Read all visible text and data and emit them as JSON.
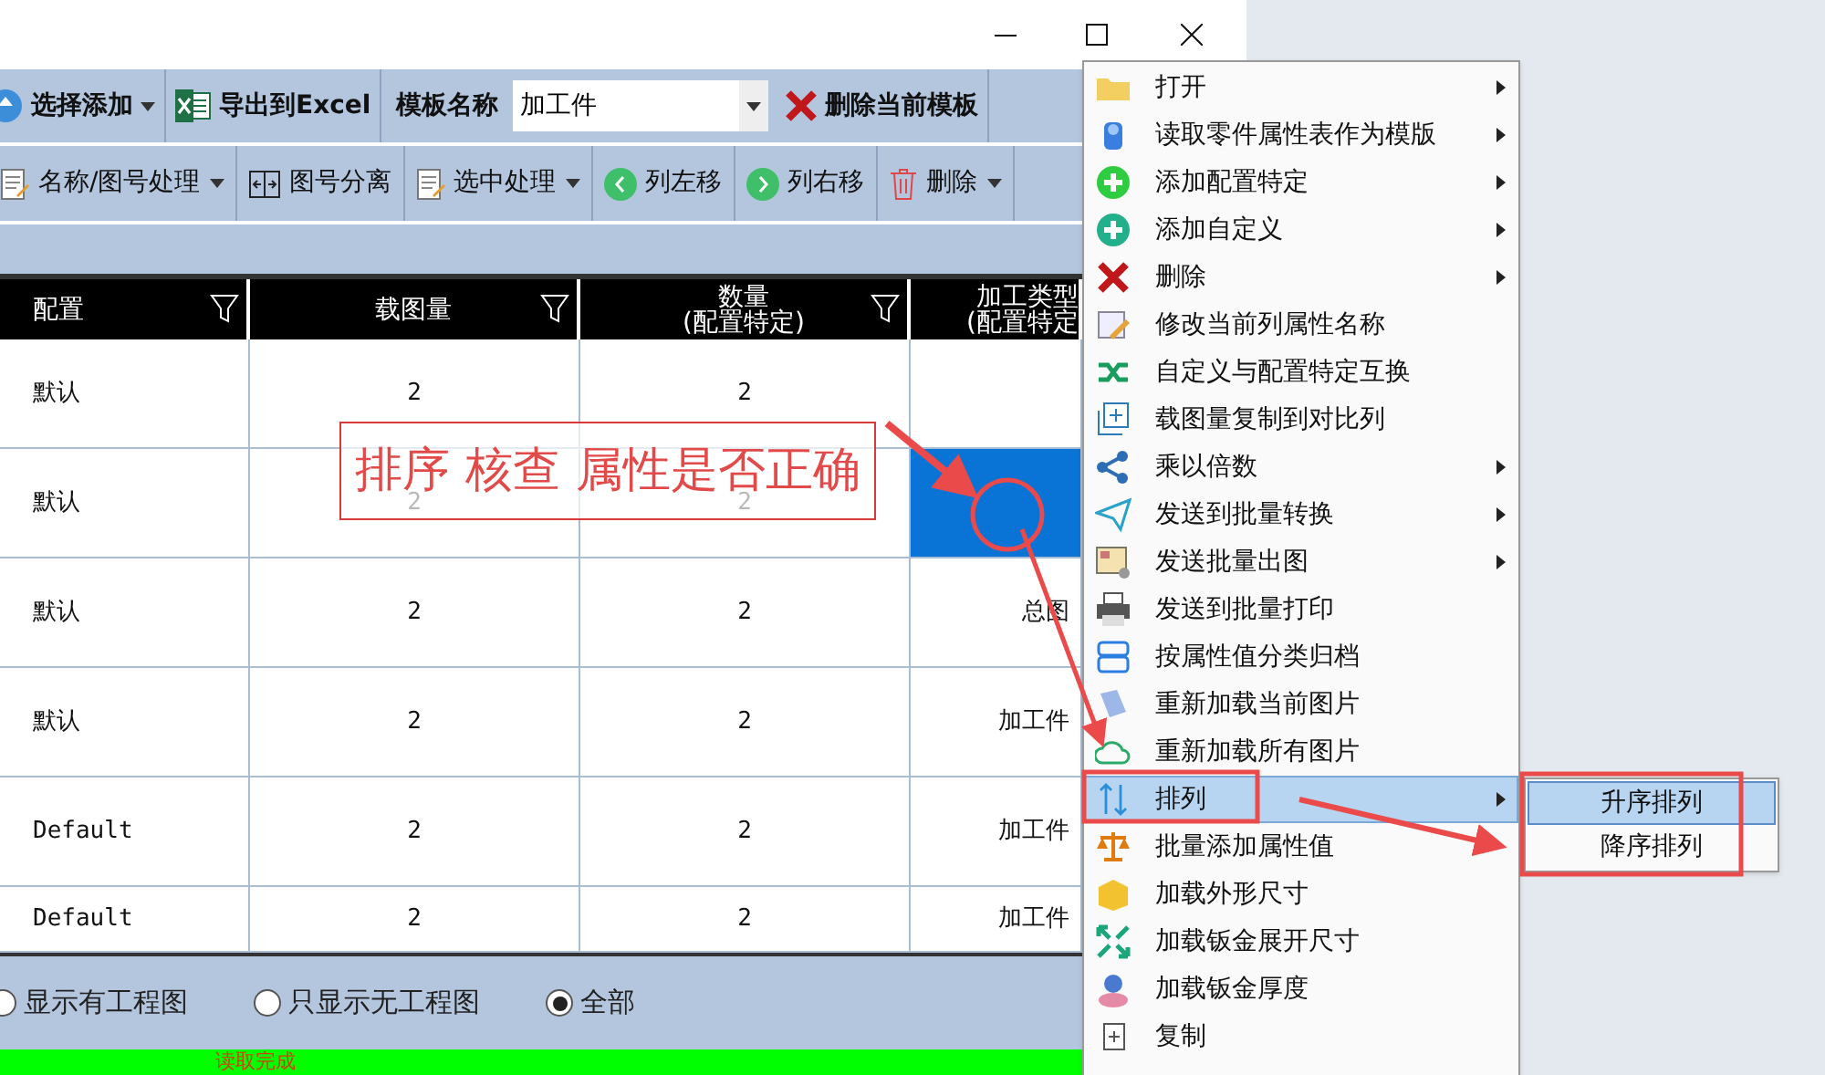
{
  "toolbar_1": [
    {
      "kind": "dropdown",
      "label": "选择添加"
    },
    {
      "kind": "excel",
      "label": "导出到Excel"
    },
    {
      "kind": "label",
      "label": "模板名称"
    },
    {
      "kind": "combo",
      "value": "加工件"
    },
    {
      "kind": "delete",
      "label": "删除当前模板"
    }
  ],
  "toolbar_2": [
    {
      "kind": "dropdown",
      "label": "名称/图号处理"
    },
    {
      "kind": "button",
      "label": "图号分离"
    },
    {
      "kind": "dropdown",
      "label": "选中处理"
    },
    {
      "kind": "left",
      "label": "列左移"
    },
    {
      "kind": "right",
      "label": "列右移"
    },
    {
      "kind": "trash",
      "label": "删除"
    }
  ],
  "table": {
    "columns": [
      {
        "title": "配置",
        "filter": true
      },
      {
        "title": "载图量",
        "filter": true
      },
      {
        "title": "数量",
        "subtitle": "(配置特定)",
        "filter": true
      },
      {
        "title": "加工类型",
        "subtitle": "(配置特定",
        "filter": false
      }
    ],
    "rows": [
      {
        "cells": [
          "默认",
          "2",
          "2"
        ],
        "selected": false
      },
      {
        "cells": [
          "默认",
          "2",
          "2"
        ],
        "selected": true
      },
      {
        "cells": [
          "默认",
          "2",
          "2",
          "总图"
        ],
        "selected": false
      },
      {
        "cells": [
          "默认",
          "2",
          "2",
          "加工件"
        ],
        "selected": false
      },
      {
        "cells": [
          "Default",
          "2",
          "2",
          "加工件"
        ],
        "selected": false
      },
      {
        "cells": [
          "Default",
          "2",
          "2",
          "加工件"
        ],
        "selected": false
      }
    ]
  },
  "filter_options": [
    {
      "label": "显示有工程图",
      "selected": false
    },
    {
      "label": "只显示无工程图",
      "selected": false
    },
    {
      "label": "全部",
      "selected": true
    }
  ],
  "status_bar": "读取完成",
  "annotation": "排序 核查 属性是否正确",
  "context_menu": [
    {
      "label": "打开",
      "submenu": true,
      "selected": false
    },
    {
      "label": "读取零件属性表作为模版",
      "submenu": true,
      "selected": false
    },
    {
      "label": "添加配置特定",
      "submenu": true,
      "selected": false
    },
    {
      "label": "添加自定义",
      "submenu": true,
      "selected": false
    },
    {
      "label": "删除",
      "submenu": true,
      "selected": false
    },
    {
      "label": "修改当前列属性名称",
      "submenu": false,
      "selected": false
    },
    {
      "label": "自定义与配置特定互换",
      "submenu": false,
      "selected": false
    },
    {
      "label": "载图量复制到对比列",
      "submenu": false,
      "selected": false
    },
    {
      "label": "乘以倍数",
      "submenu": true,
      "selected": false
    },
    {
      "label": "发送到批量转换",
      "submenu": true,
      "selected": false
    },
    {
      "label": "发送批量出图",
      "submenu": true,
      "selected": false
    },
    {
      "label": "发送到批量打印",
      "submenu": false,
      "selected": false
    },
    {
      "label": "按属性值分类归档",
      "submenu": false,
      "selected": false
    },
    {
      "label": "重新加载当前图片",
      "submenu": false,
      "selected": false
    },
    {
      "label": "重新加载所有图片",
      "submenu": false,
      "selected": false
    },
    {
      "label": "排列",
      "submenu": true,
      "selected": true
    },
    {
      "label": "批量添加属性值",
      "submenu": false,
      "selected": false
    },
    {
      "label": "加载外形尺寸",
      "submenu": false,
      "selected": false
    },
    {
      "label": "加载钣金展开尺寸",
      "submenu": false,
      "selected": false
    },
    {
      "label": "加载钣金厚度",
      "submenu": false,
      "selected": false
    },
    {
      "label": "复制",
      "submenu": false,
      "selected": false
    }
  ],
  "submenu": [
    {
      "label": "升序排列",
      "selected": true
    },
    {
      "label": "降序排列",
      "selected": false
    }
  ]
}
